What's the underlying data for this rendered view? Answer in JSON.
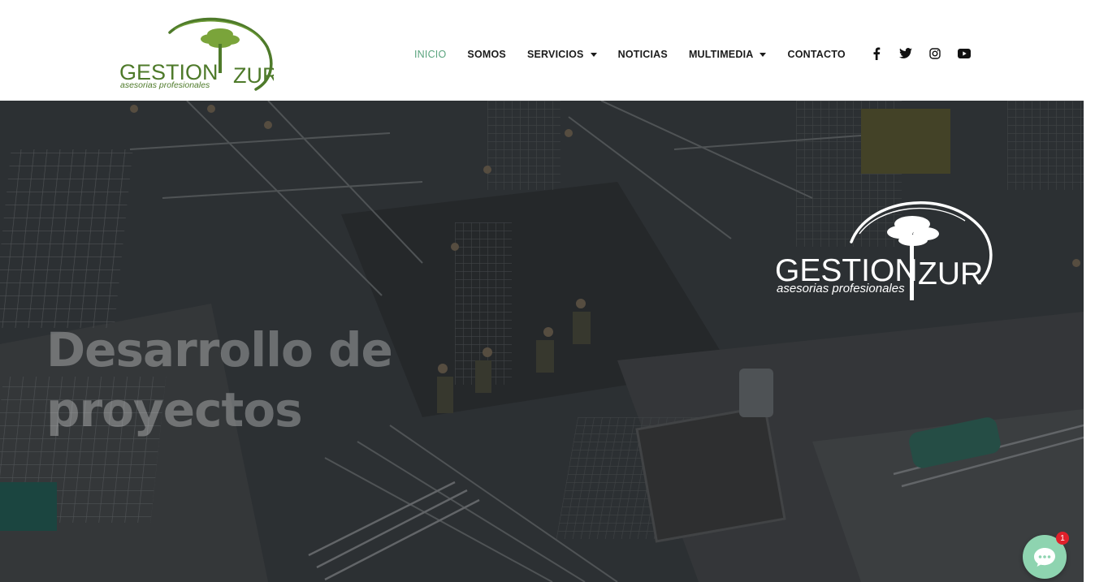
{
  "brand": {
    "name_left": "GESTION",
    "name_right": "ZUR",
    "tagline": "asesorias profesionales",
    "color_dark": "#4e7a2a",
    "color_accent": "#6b9a34"
  },
  "nav": {
    "items": [
      {
        "label": "INICIO",
        "active": true
      },
      {
        "label": "SOMOS"
      },
      {
        "label": "SERVICIOS",
        "dropdown": true
      },
      {
        "label": "NOTICIAS"
      },
      {
        "label": "MULTIMEDIA",
        "dropdown": true
      },
      {
        "label": "CONTACTO"
      }
    ],
    "active_color": "#5aa47e"
  },
  "social": {
    "icons": [
      "facebook-icon",
      "twitter-icon",
      "instagram-icon",
      "youtube-icon"
    ]
  },
  "hero": {
    "title": "Desarrollo de proyectos"
  },
  "chat": {
    "badge_count": "1",
    "icon": "chat-bubble-icon",
    "color": "#8ed4b0"
  }
}
